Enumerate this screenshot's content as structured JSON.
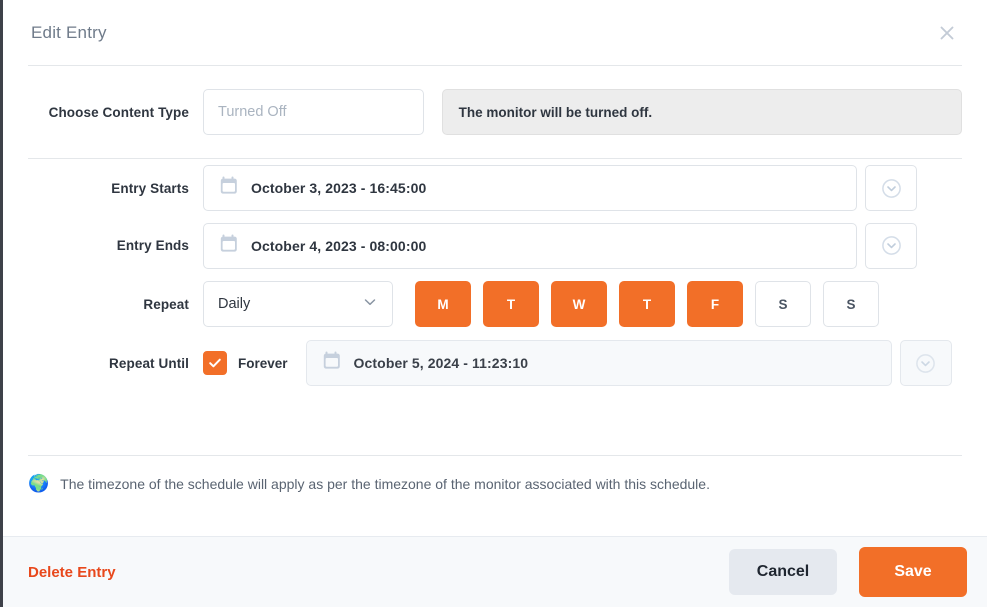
{
  "colors": {
    "accent": "#f26f28",
    "danger": "#e8481c",
    "text": "#2f3640",
    "muted": "#6f7b8a",
    "border": "#dfe3e8",
    "footer_bg": "#f7f9fb",
    "desc_bg": "#ededed"
  },
  "header": {
    "title": "Edit Entry",
    "close_icon": "close-icon"
  },
  "content_type": {
    "label": "Choose Content Type",
    "value": "Turned Off",
    "placeholder": "Turned Off",
    "description": "The monitor will be turned off."
  },
  "entry_starts": {
    "label": "Entry Starts",
    "value": "October 3, 2023 - 16:45:00",
    "calendar_icon": "calendar-icon",
    "picker_icon": "clock-chevron-icon"
  },
  "entry_ends": {
    "label": "Entry Ends",
    "value": "October 4, 2023 - 08:00:00",
    "calendar_icon": "calendar-icon",
    "picker_icon": "clock-chevron-icon"
  },
  "repeat": {
    "label": "Repeat",
    "selected": "Daily",
    "options": [
      "Daily"
    ],
    "chevron_icon": "chevron-down-icon",
    "days": [
      {
        "key": "monday",
        "label": "M",
        "selected": true
      },
      {
        "key": "tuesday",
        "label": "T",
        "selected": true
      },
      {
        "key": "wednesday",
        "label": "W",
        "selected": true
      },
      {
        "key": "thursday",
        "label": "T",
        "selected": true
      },
      {
        "key": "friday",
        "label": "F",
        "selected": true
      },
      {
        "key": "saturday",
        "label": "S",
        "selected": false
      },
      {
        "key": "sunday",
        "label": "S",
        "selected": false
      }
    ]
  },
  "repeat_until": {
    "label": "Repeat Until",
    "forever_label": "Forever",
    "forever_checked": true,
    "check_icon": "check-icon",
    "value": "October 5, 2024 - 11:23:10",
    "calendar_icon": "calendar-icon",
    "picker_icon": "clock-chevron-icon",
    "disabled": true
  },
  "note": {
    "icon": "globe-icon",
    "glyph": "🌍",
    "text": "The timezone of the schedule will apply as per the timezone of the monitor associated with this schedule."
  },
  "footer": {
    "delete_label": "Delete Entry",
    "cancel_label": "Cancel",
    "save_label": "Save"
  }
}
